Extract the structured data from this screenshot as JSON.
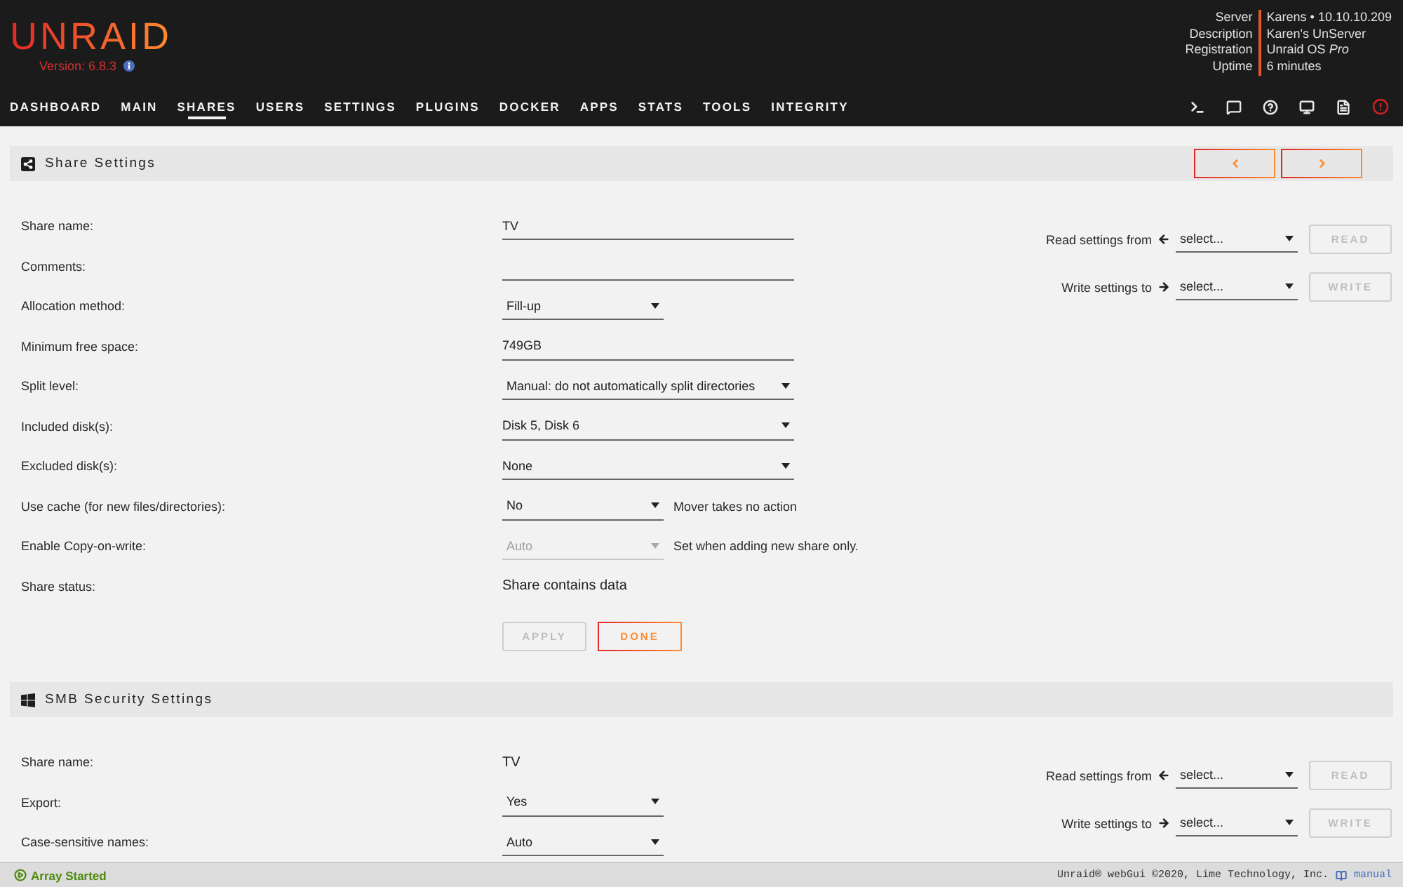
{
  "header": {
    "logo": "UNRAID",
    "version": "Version: 6.8.3",
    "server_info": [
      {
        "label": "Server",
        "value": "Karens • 10.10.10.209"
      },
      {
        "label": "Description",
        "value": "Karen's UnServer"
      },
      {
        "label": "Registration",
        "value": "Unraid OS *Pro*"
      },
      {
        "label": "Uptime",
        "value": "6 minutes"
      }
    ]
  },
  "nav": [
    {
      "label": "DASHBOARD",
      "selected": false
    },
    {
      "label": "MAIN",
      "selected": false
    },
    {
      "label": "SHARES",
      "selected": true
    },
    {
      "label": "USERS",
      "selected": false
    },
    {
      "label": "SETTINGS",
      "selected": false
    },
    {
      "label": "PLUGINS",
      "selected": false
    },
    {
      "label": "DOCKER",
      "selected": false
    },
    {
      "label": "APPS",
      "selected": false
    },
    {
      "label": "STATS",
      "selected": false
    },
    {
      "label": "TOOLS",
      "selected": false
    },
    {
      "label": "INTEGRITY",
      "selected": false
    }
  ],
  "sections": [
    {
      "kind": "share",
      "title": "Share Settings",
      "pager_buttons": [
        {
          "kind": "previous"
        },
        {
          "kind": "next"
        }
      ],
      "fields": [
        {
          "label": "Share name:",
          "kind": "input",
          "value": "TV",
          "disabled": false
        },
        {
          "label": "Comments:",
          "kind": "input",
          "disabled": false
        },
        {
          "label": "Allocation method:",
          "kind": "select",
          "value": "Fill-up",
          "disabled": false
        },
        {
          "label": "Minimum free space:",
          "kind": "input",
          "value": "749GB",
          "disabled": false
        },
        {
          "label": "Split level:",
          "kind": "wide-select",
          "value": "Manual: do not automatically split directories",
          "disabled": false
        },
        {
          "label": "Included disk(s):",
          "kind": "multi-select",
          "value": "Disk 5, Disk 6",
          "disabled": false
        },
        {
          "label": "Excluded disk(s):",
          "kind": "multi-select",
          "value": "None",
          "disabled": false
        },
        {
          "label": "Use cache (for new files/directories):",
          "kind": "select",
          "value": "No",
          "note": "Mover takes no action",
          "disabled": false
        },
        {
          "label": "Enable Copy-on-write:",
          "kind": "select",
          "value": "Auto",
          "note": "Set when adding new share only.",
          "disabled": true
        },
        {
          "label": "Share status:",
          "kind": "text",
          "value": "Share contains data",
          "disabled": false
        }
      ],
      "buttons": [
        {
          "label": "APPLY",
          "disabled": true
        },
        {
          "label": "DONE",
          "disabled": false
        }
      ],
      "copy_settings": [
        {
          "kind": "read",
          "label": "Read settings from",
          "select": "select...",
          "button": "READ",
          "disabled": true
        },
        {
          "kind": "write",
          "label": "Write settings to",
          "select": "select...",
          "button": "WRITE",
          "disabled": true
        }
      ]
    },
    {
      "kind": "smb",
      "title": "SMB Security Settings",
      "fields": [
        {
          "label": "Share name:",
          "kind": "text",
          "value": "TV",
          "disabled": false
        },
        {
          "label": "Export:",
          "kind": "select",
          "value": "Yes",
          "disabled": false
        },
        {
          "label": "Case-sensitive names:",
          "kind": "select",
          "value": "Auto",
          "disabled": false
        }
      ],
      "copy_settings": [
        {
          "kind": "read",
          "label": "Read settings from",
          "select": "select...",
          "button": "READ",
          "disabled": true
        },
        {
          "kind": "write",
          "label": "Write settings to",
          "select": "select...",
          "button": "WRITE",
          "disabled": true
        }
      ]
    }
  ],
  "footer": {
    "status": "Array Started",
    "copyright": "Unraid® webGui ©2020, Lime Technology, Inc.",
    "link": "manual"
  }
}
